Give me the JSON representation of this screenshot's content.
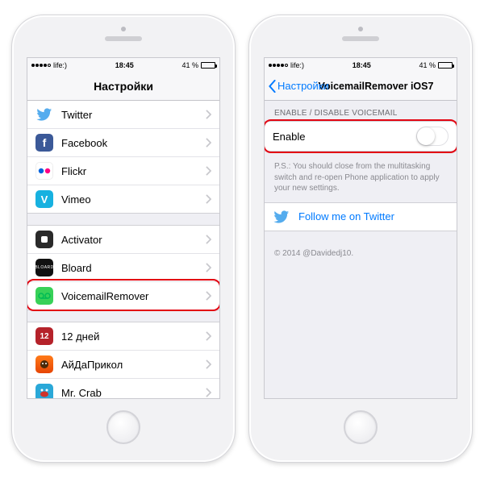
{
  "status": {
    "carrier": "life:)",
    "time": "18:45",
    "battery_pct": "41 %"
  },
  "left": {
    "nav_title": "Настройки",
    "groups": [
      {
        "rows": [
          {
            "icon": "twitter",
            "label": "Twitter"
          },
          {
            "icon": "facebook",
            "label": "Facebook"
          },
          {
            "icon": "flickr",
            "label": "Flickr"
          },
          {
            "icon": "vimeo",
            "label": "Vimeo"
          }
        ]
      },
      {
        "rows": [
          {
            "icon": "activator",
            "label": "Activator"
          },
          {
            "icon": "bloard",
            "label": "Bloard"
          },
          {
            "icon": "voicemail",
            "label": "VoicemailRemover",
            "highlight": true
          }
        ]
      },
      {
        "rows": [
          {
            "icon": "twelve",
            "label": "12 дней"
          },
          {
            "icon": "aida",
            "label": "АйДаПрикол"
          },
          {
            "icon": "crab",
            "label": "Mr. Crab"
          }
        ]
      }
    ]
  },
  "right": {
    "nav_back": "Настройки",
    "nav_title": "VoicemailRemover iOS7",
    "section_header": "ENABLE / DISABLE VOICEMAIL",
    "enable_label": "Enable",
    "note": "P.S.: You should close from the multitasking switch and re-open Phone application to apply your new settings.",
    "twitter_link": "Follow me on Twitter",
    "copyright": "© 2014 @Davidedj10."
  }
}
